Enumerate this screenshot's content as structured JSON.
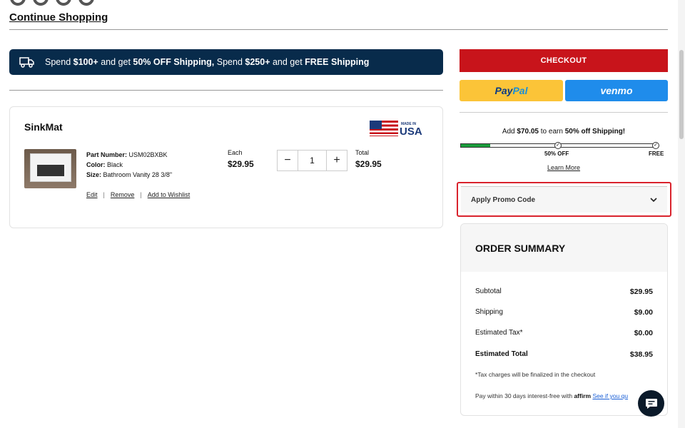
{
  "nav": {
    "continue_label": "Continue Shopping"
  },
  "banner": {
    "t1": "Spend ",
    "t2": "$100+",
    "t3": " and get ",
    "t4": "50% OFF Shipping,",
    "t5": " Spend ",
    "t6": "$250+",
    "t7": " and get ",
    "t8": "FREE Shipping"
  },
  "item": {
    "title": "SinkMat",
    "badge_made": "MADE IN",
    "badge_usa": "USA",
    "part_label": "Part Number:",
    "part_value": "USM02BXBK",
    "color_label": "Color:",
    "color_value": "Black",
    "size_label": "Size:",
    "size_value": "Bathroom Vanity 28 3/8\"",
    "each_label": "Each",
    "each_price": "$29.95",
    "qty_minus": "−",
    "qty_value": "1",
    "qty_plus": "+",
    "total_label": "Total",
    "total_price": "$29.95",
    "edit": "Edit",
    "remove": "Remove",
    "wishlist": "Add to Wishlist",
    "sep": "|"
  },
  "checkout": {
    "checkout_label": "CHECKOUT",
    "paypal_a": "Pay",
    "paypal_b": "Pal",
    "venmo": "venmo"
  },
  "shipping": {
    "m1": "Add ",
    "m2": "$70.05",
    "m3": " to earn ",
    "m4": "50% off Shipping!",
    "progress": 0.15,
    "label_half": "50% OFF",
    "label_free": "FREE",
    "learn_more": "Learn More"
  },
  "promo": {
    "label": "Apply Promo Code"
  },
  "summary": {
    "title": "ORDER SUMMARY",
    "rows": [
      {
        "label": "Subtotal",
        "value": "$29.95"
      },
      {
        "label": "Shipping",
        "value": "$9.00"
      },
      {
        "label": "Estimated Tax*",
        "value": "$0.00"
      },
      {
        "label": "Estimated Total",
        "value": "$38.95"
      }
    ],
    "tax_note": "*Tax charges will be finalized in the checkout",
    "affirm_text": "Pay within 30 days interest-free with ",
    "affirm_brand": "affirm",
    "affirm_link": "See if you qu"
  },
  "colors": {
    "checkout_red": "#c8141b",
    "banner_navy": "#082b4b",
    "promo_highlight": "#d9232d",
    "progress_green": "#1a9d3b"
  },
  "icons": [
    "truck-icon",
    "chevron-down-icon",
    "chat-icon",
    "check-icon",
    "usa-flag-icon"
  ]
}
